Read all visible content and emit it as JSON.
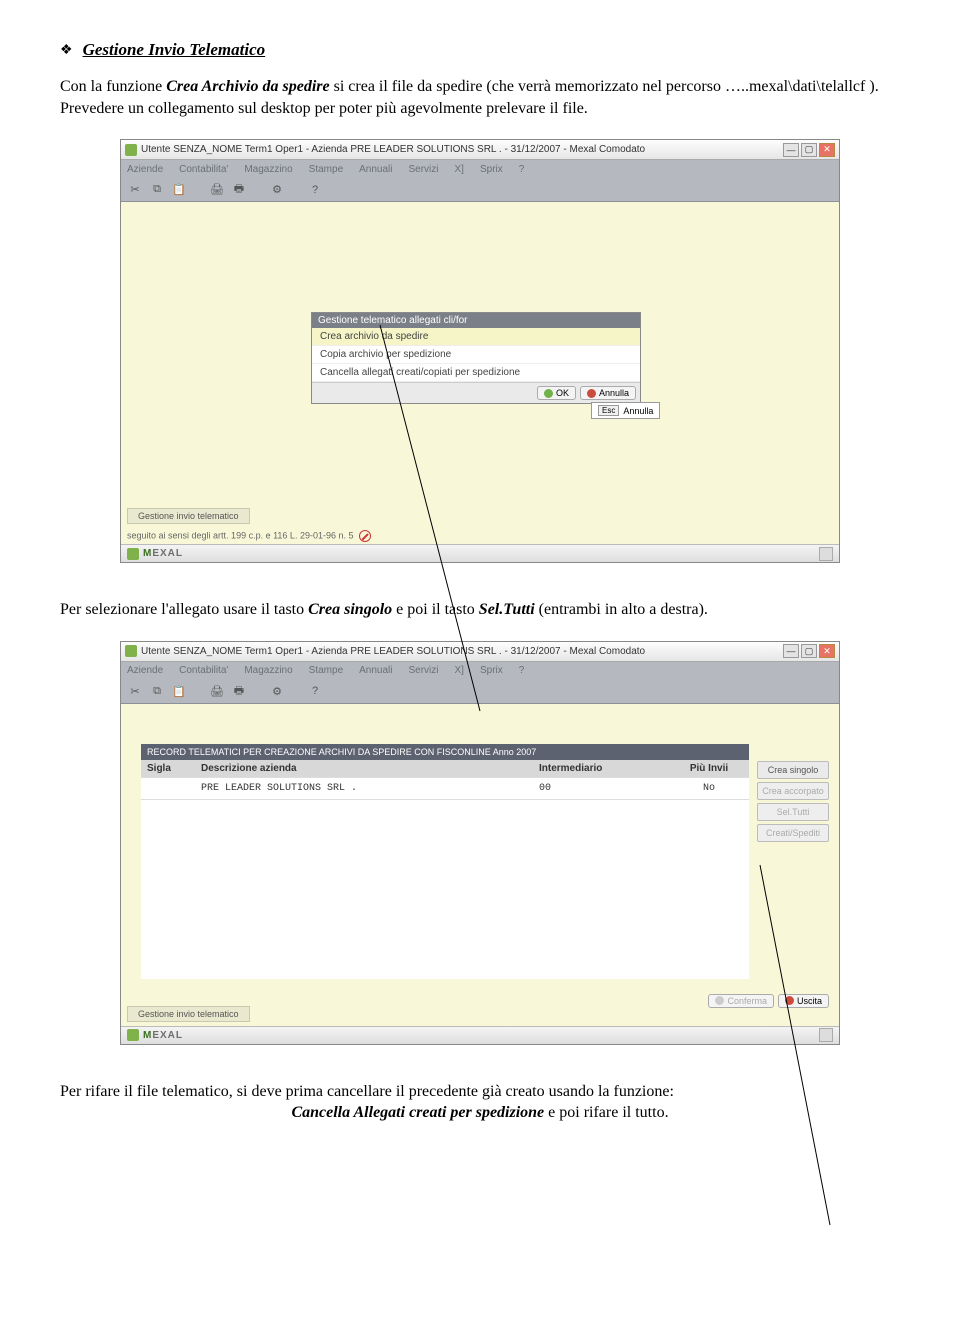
{
  "doc": {
    "heading": "Gestione Invio Telematico",
    "p1_a": "Con la funzione ",
    "p1_b": "Crea Archivio da spedire",
    "p1_c": " si crea il file da spedire (che verrà memorizzato nel percorso …..mexal\\dati\\telallcf ). Prevedere un collegamento sul desktop per poter più agevolmente prelevare il file.",
    "p2_a": "Per selezionare l'allegato usare il tasto ",
    "p2_b": "Crea singolo",
    "p2_c": " e poi il tasto ",
    "p2_d": "Sel.Tutti",
    "p2_e": " (entrambi in alto a destra).",
    "p3_a": "Per rifare il file telematico, si deve prima cancellare il precedente già creato usando la funzione: ",
    "p3_b": "Cancella Allegati creati per spedizione",
    "p3_c": " e poi rifare il tutto."
  },
  "app": {
    "title": "Utente SENZA_NOME Term1 Oper1 - Azienda PRE LEADER SOLUTIONS SRL . - 31/12/2007 - Mexal Comodato",
    "menu": [
      "Aziende",
      "Contabilita'",
      "Magazzino",
      "Stampe",
      "Annuali",
      "Servizi",
      "X]",
      "Sprix",
      "?"
    ],
    "brand": "MEXAL",
    "status_tag": "Gestione invio telematico",
    "footnote": "seguito ai sensi degli artt. 199 c.p. e 116 L. 29-01-96 n. 5"
  },
  "dialog": {
    "title": "Gestione telematico allegati cli/for",
    "items": [
      "Crea archivio da spedire",
      "Copia archivio per spedizione",
      "Cancella allegati creati/copiati per spedizione"
    ],
    "ok": "OK",
    "cancel": "Annulla",
    "hint_key": "Esc",
    "hint_label": "Annulla"
  },
  "grid": {
    "banner": "RECORD TELEMATICI PER CREAZIONE ARCHIVI DA SPEDIRE CON FISCONLINE Anno 2007",
    "headers": {
      "sigla": "Sigla",
      "desc": "Descrizione azienda",
      "inter": "Intermediario",
      "piu": "Più Invii"
    },
    "row": {
      "sigla": "",
      "desc": "PRE LEADER SOLUTIONS SRL .",
      "inter": "00",
      "piu": "No"
    },
    "side": [
      "Crea singolo",
      "Crea accorpato",
      "Sel.Tutti",
      "Creati/Spediti"
    ],
    "confirm": "Conferma",
    "exit": "Uscita"
  }
}
